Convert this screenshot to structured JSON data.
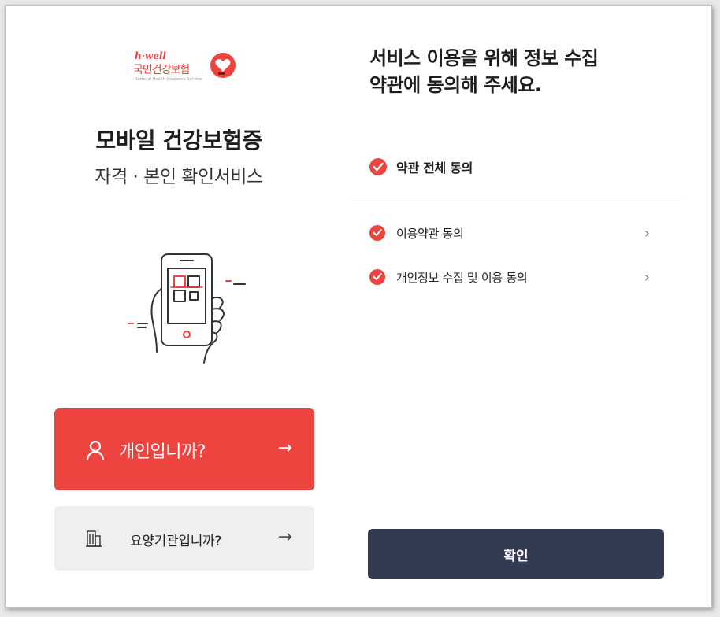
{
  "brand": {
    "tagline": "h·well",
    "name": "국민건강보험",
    "name_en": "National Health Insurance Service",
    "accent_color": "#ee4440"
  },
  "left": {
    "title": "모바일 건강보험증",
    "subtitle": "자격 · 본인 확인서비스",
    "illustration_icon": "phone-qr-scan-icon",
    "personal_button": {
      "label": "개인입니까?",
      "icon": "user-icon",
      "arrow": "→"
    },
    "facility_button": {
      "label": "요양기관입니까?",
      "icon": "building-icon",
      "arrow": "→"
    }
  },
  "right": {
    "heading_line1": "서비스 이용을 위해 정보 수집",
    "heading_line2": "약관에 동의해 주세요.",
    "agree_all": "약관 전체 동의",
    "terms": [
      {
        "label": "이용약관 동의",
        "checked": true
      },
      {
        "label": "개인정보 수집 및 이용 동의",
        "checked": true
      }
    ],
    "chevron": "›",
    "confirm_label": "확인",
    "confirm_color": "#333b52"
  }
}
